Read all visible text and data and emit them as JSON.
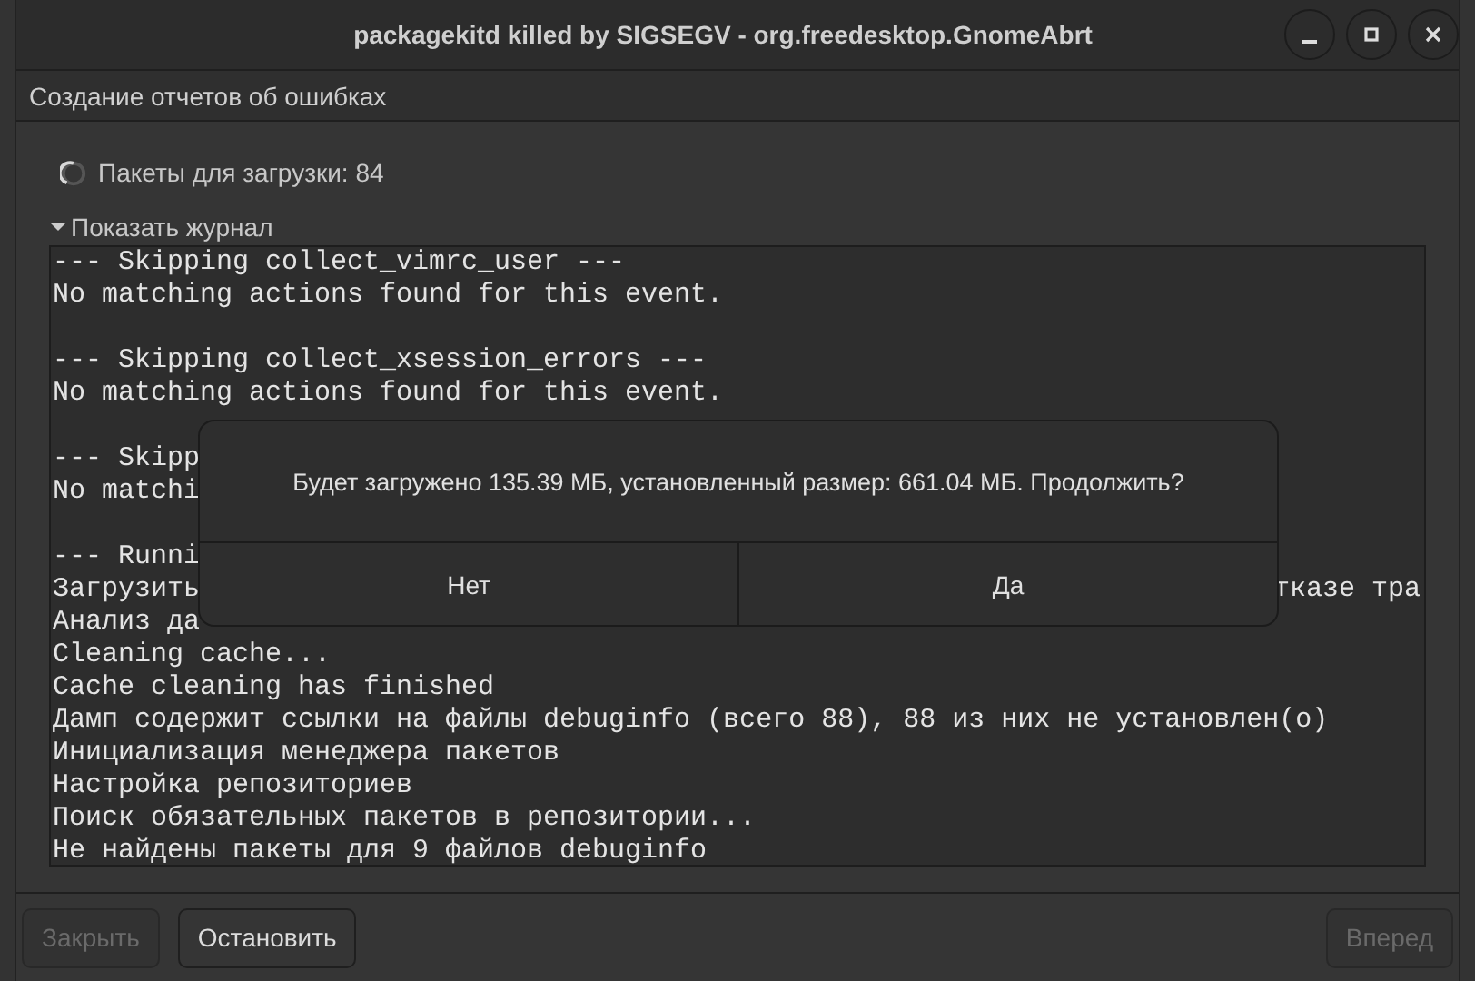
{
  "window": {
    "title": "packagekitd killed by SIGSEGV - org.freedesktop.GnomeAbrt"
  },
  "subtitle": "Создание отчетов об ошибках",
  "status": {
    "busy": true,
    "text": "Пакеты для загрузки: 84"
  },
  "log": {
    "expander": {
      "label": "Показать журнал",
      "expanded": true
    },
    "lines": [
      {
        "kind": "text",
        "text": "--- Skipping collect_vimrc_user ---"
      },
      {
        "kind": "text",
        "text": "No matching actions found for this event."
      },
      {
        "kind": "blank"
      },
      {
        "kind": "text",
        "text": "--- Skipping collect_xsession_errors ---"
      },
      {
        "kind": "text",
        "text": "No matching actions found for this event."
      },
      {
        "kind": "blank"
      },
      {
        "kind": "text",
        "text": "--- Skipp"
      },
      {
        "kind": "text",
        "text": "No matchi"
      },
      {
        "kind": "blank"
      },
      {
        "kind": "text",
        "text": "--- Runni"
      },
      {
        "kind": "text",
        "text": "Загрузить",
        "tail": "тказе тра"
      },
      {
        "kind": "text",
        "text": "Анализ да"
      },
      {
        "kind": "text",
        "text": "Cleaning cache..."
      },
      {
        "kind": "text",
        "text": "Cache cleaning has finished"
      },
      {
        "kind": "text",
        "text": "Дамп содержит ссылки на файлы debuginfo (всего 88), 88 из них не установлен(о)"
      },
      {
        "kind": "text",
        "text": "Инициализация менеджера пакетов"
      },
      {
        "kind": "text",
        "text": "Настройка репозиториев"
      },
      {
        "kind": "text",
        "text": "Поиск обязательных пакетов в репозитории..."
      },
      {
        "kind": "text",
        "text": "Не найдены пакеты для 9 файлов debuginfo"
      }
    ]
  },
  "dialog": {
    "message": "Будет загружено 135.39 МБ, установленный размер: 661.04 МБ. Продолжить?",
    "buttons": [
      "Нет",
      "Да"
    ]
  },
  "footer": {
    "left": [
      {
        "label": "Закрыть",
        "disabled": true
      },
      {
        "label": "Остановить",
        "disabled": false
      }
    ],
    "right": [
      {
        "label": "Вперед",
        "disabled": true
      }
    ]
  }
}
